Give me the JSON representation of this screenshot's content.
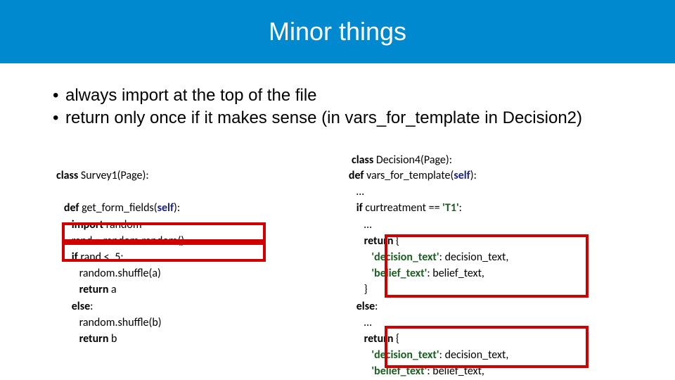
{
  "title": "Minor things",
  "bullets": {
    "b1": "always import at the top of the file",
    "b2": "return only once if it makes sense (in vars_for_template in Decision2)"
  },
  "left": {
    "classkw": "class",
    "classname": " Survey1(Page):",
    "defkw": "def",
    "defname": " get_form_fields(",
    "self": "self",
    "closeparen": "):",
    "importkw": "import",
    "importname": " random",
    "randline": "rand = random.random()",
    "ifkw": "if",
    "ifcond": " rand < .5:",
    "shufA": "random.shuffle(a)",
    "retkw1": "return",
    "retA": " a",
    "elsekw": "else",
    "elsecolon": ":",
    "shufB": "random.shuffle(b)",
    "retkw2": "return",
    "retB": " b"
  },
  "right": {
    "classkw": "class",
    "classname": " Decision4(Page):",
    "defkw": "def",
    "defname": " vars_for_template(",
    "self": "self",
    "closeparen": "):",
    "dots1": "…",
    "ifkw": "if",
    "ifcond": " curtreatment == ",
    "t1str": "'T1'",
    "colon": ":",
    "dots2": "…",
    "retkw1": "return",
    "brace1": " {",
    "dt_key": "'decision_text'",
    "dt_val": ": decision_text,",
    "bt_key": "'belief_text'",
    "bt_val": ": belief_text,",
    "close1": "}",
    "elsekw": "else",
    "elsecolon": ":",
    "dots3": "…",
    "retkw2": "return",
    "brace2": " {",
    "dt_key2": "'decision_text'",
    "dt_val2": ": decision_text,",
    "bt_key2": "'belief_text'",
    "bt_val2": ": belief_text,"
  }
}
